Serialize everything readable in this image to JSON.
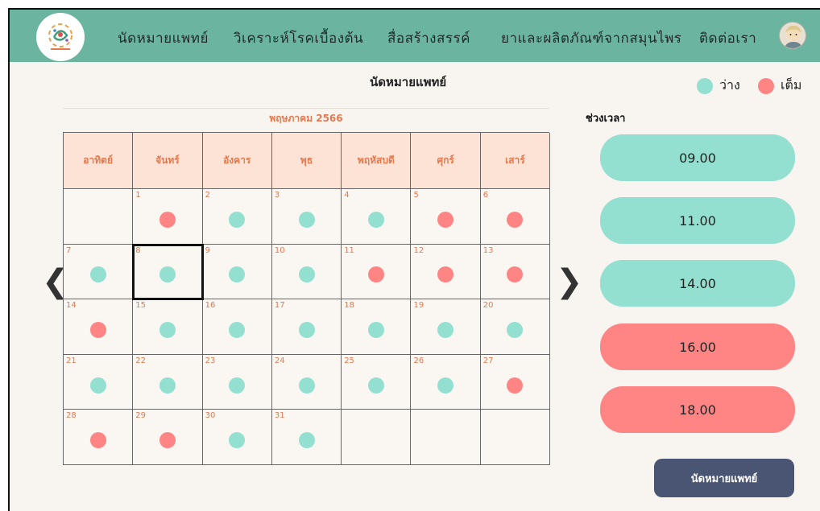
{
  "colors": {
    "nav": "#6bb5a0",
    "available": "#93e0d1",
    "full": "#ff8585",
    "header": "#fde2d6",
    "accent": "#e27a50",
    "button": "#4a5573"
  },
  "nav": {
    "items": [
      "นัดหมายแพทย์",
      "วิเคราะห์โรคเบื้องต้น",
      "สื่อสร้างสรรค์",
      "ยาและผลิตภัณฑ์จากสมุนไพร",
      "ติดต่อเรา"
    ],
    "logo_icon": "herbal-logo-icon",
    "avatar_icon": "user-avatar-icon"
  },
  "page": {
    "title": "นัดหมายแพทย์"
  },
  "legend": {
    "available": "ว่าง",
    "full": "เต็ม"
  },
  "calendar": {
    "month": "พฤษภาคม 2566",
    "weekdays": [
      "อาทิตย์",
      "จันทร์",
      "อังคาร",
      "พุธ",
      "พฤหัสบดี",
      "ศุกร์",
      "เสาร์"
    ],
    "selected_day": 8,
    "days": [
      {
        "day": "1",
        "status": "full"
      },
      {
        "day": "2",
        "status": "available"
      },
      {
        "day": "3",
        "status": "available"
      },
      {
        "day": "4",
        "status": "available"
      },
      {
        "day": "5",
        "status": "full"
      },
      {
        "day": "6",
        "status": "full"
      },
      {
        "day": "7",
        "status": "available"
      },
      {
        "day": "8",
        "status": "available"
      },
      {
        "day": "9",
        "status": "available"
      },
      {
        "day": "10",
        "status": "available"
      },
      {
        "day": "11",
        "status": "full"
      },
      {
        "day": "12",
        "status": "full"
      },
      {
        "day": "13",
        "status": "full"
      },
      {
        "day": "14",
        "status": "full"
      },
      {
        "day": "15",
        "status": "available"
      },
      {
        "day": "16",
        "status": "available"
      },
      {
        "day": "17",
        "status": "available"
      },
      {
        "day": "18",
        "status": "available"
      },
      {
        "day": "19",
        "status": "available"
      },
      {
        "day": "20",
        "status": "available"
      },
      {
        "day": "21",
        "status": "available"
      },
      {
        "day": "22",
        "status": "available"
      },
      {
        "day": "23",
        "status": "available"
      },
      {
        "day": "24",
        "status": "available"
      },
      {
        "day": "25",
        "status": "available"
      },
      {
        "day": "26",
        "status": "available"
      },
      {
        "day": "27",
        "status": "full"
      },
      {
        "day": "28",
        "status": "full"
      },
      {
        "day": "29",
        "status": "full"
      },
      {
        "day": "30",
        "status": "available"
      },
      {
        "day": "31",
        "status": "available"
      }
    ],
    "prev_icon": "chevron-left-icon",
    "next_icon": "chevron-right-icon",
    "prev_glyph": "❮",
    "next_glyph": "❯"
  },
  "timeslots": {
    "title": "ช่วงเวลา",
    "slots": [
      {
        "time": "09.00",
        "status": "available"
      },
      {
        "time": "11.00",
        "status": "available"
      },
      {
        "time": "14.00",
        "status": "available"
      },
      {
        "time": "16.00",
        "status": "full"
      },
      {
        "time": "18.00",
        "status": "full"
      }
    ]
  },
  "actions": {
    "book_label": "นัดหมายแพทย์"
  }
}
